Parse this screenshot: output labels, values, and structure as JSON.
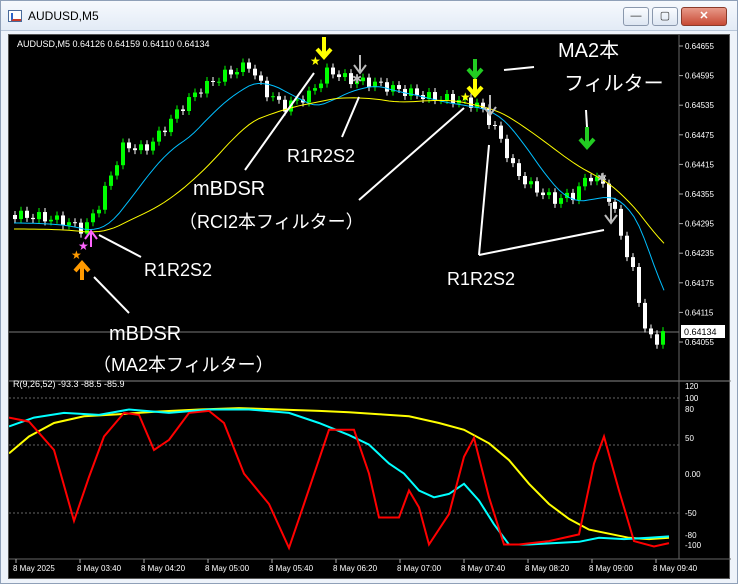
{
  "window": {
    "title": "AUDUSD,M5"
  },
  "controls": {
    "minimize": "—",
    "maximize": "▢",
    "close": "✕"
  },
  "main_chart": {
    "header": "AUDUSD,M5  0.64126 0.64159 0.64110 0.64134",
    "current_price": "0.64134",
    "price_labels": [
      "0.64655",
      "0.64595",
      "0.64535",
      "0.64475",
      "0.64415",
      "0.64355",
      "0.64295",
      "0.64235",
      "0.64175",
      "0.64115",
      "0.64055"
    ]
  },
  "annotations": {
    "label_ma_filter_top": "MA2本",
    "label_ma_filter_top2": "フィルター",
    "label_r1r2s2_a": "R1R2S2",
    "label_mbdsr_rci": "mBDSR",
    "label_rci_filter": "（RCI2本フィルター）",
    "label_r1r2s2_b": "R1R2S2",
    "label_r1r2s2_c": "R1R2S2",
    "label_mbdsr_ma": "mBDSR",
    "label_ma_filter_bottom": "（MA2本フィルター）"
  },
  "indicator": {
    "header": "R(9,26,52) -93.3 -88.5 -85.9",
    "levels": [
      "120",
      "100",
      "80",
      "50",
      "0.00",
      "-50",
      "-80",
      "-100"
    ]
  },
  "time_axis": {
    "labels": [
      "8 May 2025",
      "8 May 03:40",
      "8 May 04:20",
      "8 May 05:00",
      "8 May 05:40",
      "8 May 06:20",
      "8 May 07:00",
      "8 May 07:40",
      "8 May 08:20",
      "8 May 09:00",
      "8 May 09:40"
    ]
  },
  "colors": {
    "up_candle": "#00ff00",
    "down_candle": "#ffffff",
    "ma_fast": "#00bfff",
    "ma_slow": "#ffff00",
    "rci_short": "#ff0000",
    "rci_mid": "#00ffff",
    "rci_long": "#ffff00"
  }
}
